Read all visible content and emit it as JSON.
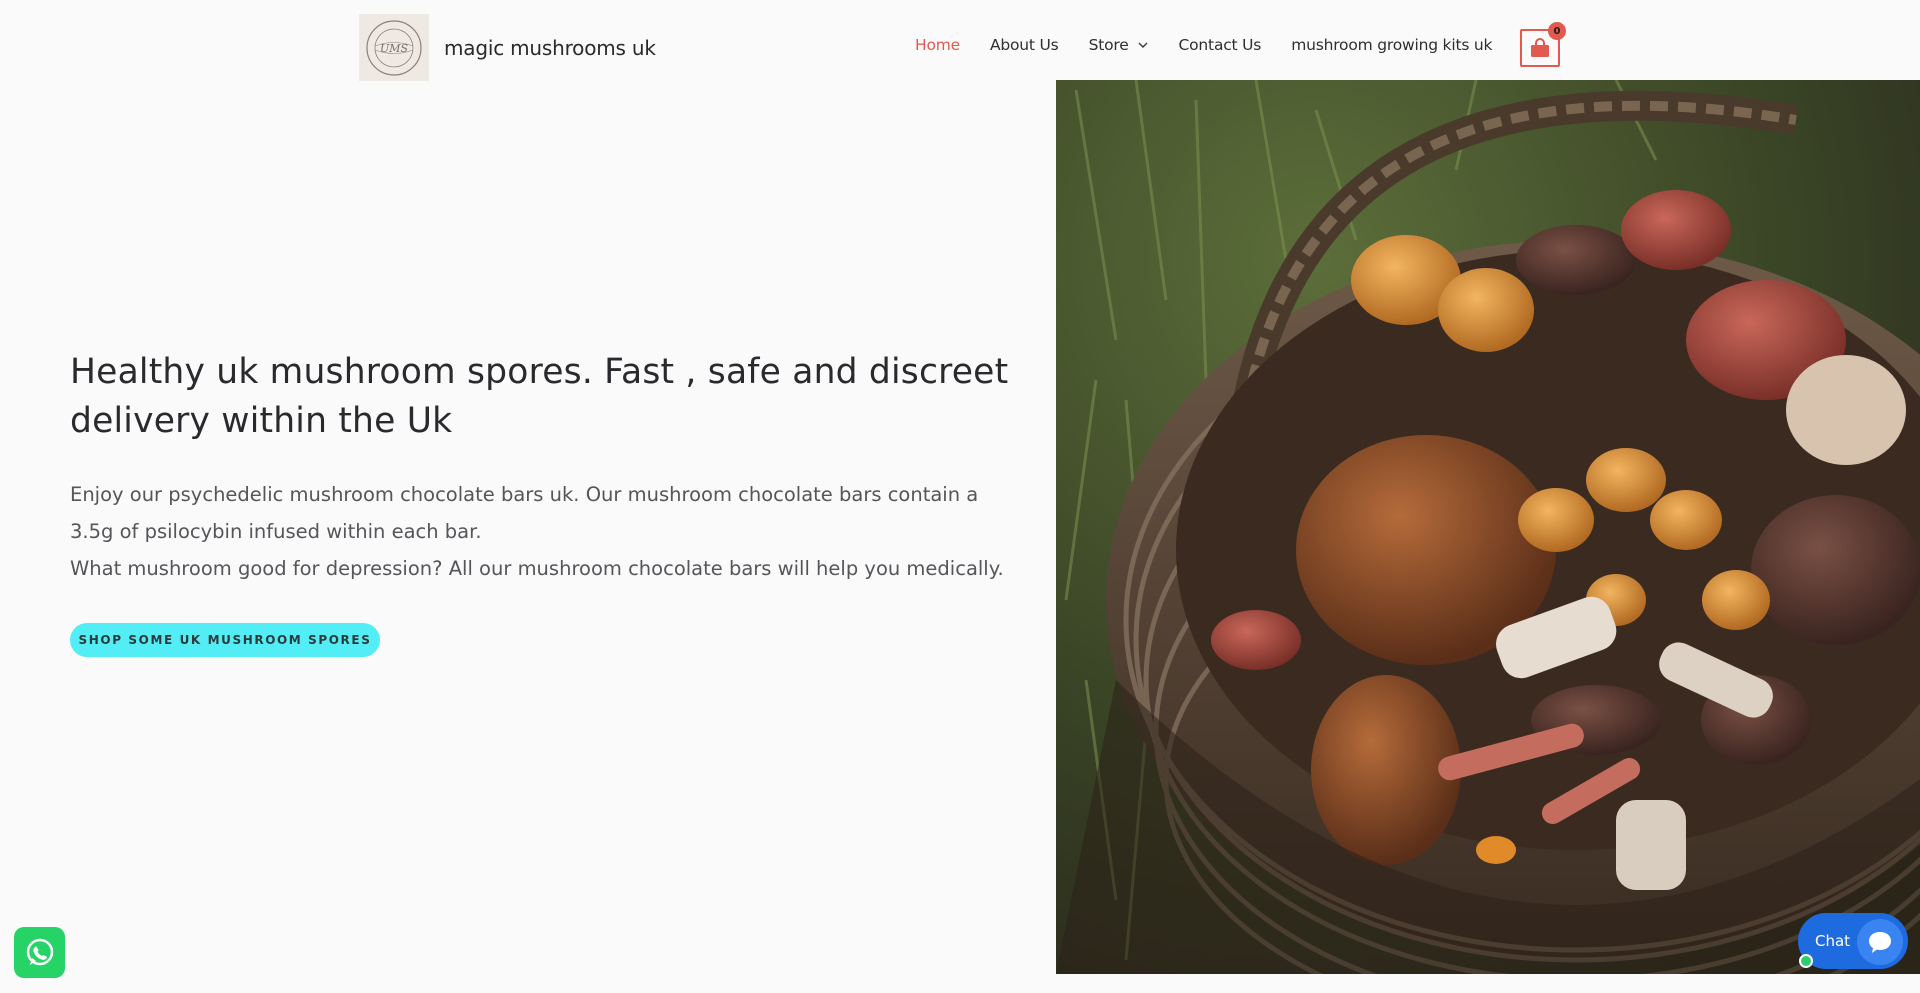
{
  "header": {
    "logo_alt": "UMS",
    "logo_ring_text": "UK MUSHROOM SPORES",
    "site_title": "magic mushrooms uk",
    "nav": [
      {
        "label": "Home",
        "active": true
      },
      {
        "label": "About Us",
        "active": false
      },
      {
        "label": "Store",
        "active": false,
        "has_dropdown": true
      },
      {
        "label": "Contact Us",
        "active": false
      },
      {
        "label": "mushroom growing kits uk",
        "active": false
      }
    ],
    "cart_count": "0",
    "accent_color": "#e25a4f"
  },
  "hero": {
    "title": "Healthy uk mushroom spores. Fast , safe and discreet delivery within the Uk",
    "paragraph_1": "Enjoy our psychedelic mushroom chocolate bars uk. Our mushroom chocolate bars contain a 3.5g of psilocybin infused within each bar.",
    "paragraph_2": "What mushroom good for depression? All our mushroom chocolate bars will help you medically.",
    "cta_label": "SHOP SOME UK MUSHROOM SPORES",
    "cta_color": "#53eef5",
    "image_icon": "mushroom-basket-photo"
  },
  "widgets": {
    "whatsapp_icon": "whatsapp-icon",
    "chat_label": "Chat",
    "chat_icon": "chat-bubble-icon",
    "chat_color": "#1e6be0"
  }
}
